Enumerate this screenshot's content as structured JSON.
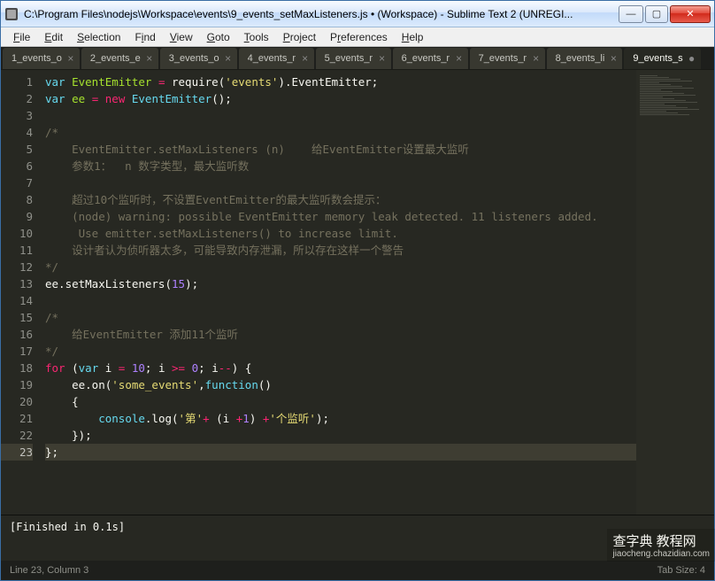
{
  "window": {
    "title": "C:\\Program Files\\nodejs\\Workspace\\events\\9_events_setMaxListeners.js • (Workspace) - Sublime Text 2 (UNREGI..."
  },
  "win_buttons": {
    "min": "—",
    "max": "▢",
    "close": "✕"
  },
  "menu": {
    "file": "File",
    "edit": "Edit",
    "selection": "Selection",
    "find": "Find",
    "view": "View",
    "goto": "Goto",
    "tools": "Tools",
    "project": "Project",
    "preferences": "Preferences",
    "help": "Help"
  },
  "tabs": [
    {
      "label": "1_events_o",
      "close": "×",
      "active": false
    },
    {
      "label": "2_events_e",
      "close": "×",
      "active": false
    },
    {
      "label": "3_events_o",
      "close": "×",
      "active": false
    },
    {
      "label": "4_events_r",
      "close": "×",
      "active": false
    },
    {
      "label": "5_events_r",
      "close": "×",
      "active": false
    },
    {
      "label": "6_events_r",
      "close": "×",
      "active": false
    },
    {
      "label": "7_events_r",
      "close": "×",
      "active": false
    },
    {
      "label": "8_events_li",
      "close": "×",
      "active": false
    },
    {
      "label": "9_events_s",
      "close": "●",
      "active": true
    }
  ],
  "code": {
    "highlight_line": 23,
    "lines": [
      {
        "n": 1,
        "tokens": [
          [
            "k-blue",
            "var"
          ],
          [
            "k-white",
            " "
          ],
          [
            "k-green",
            "EventEmitter"
          ],
          [
            "k-white",
            " "
          ],
          [
            "k-red",
            "="
          ],
          [
            "k-white",
            " require("
          ],
          [
            "k-yellow",
            "'events'"
          ],
          [
            "k-white",
            ")."
          ],
          [
            "k-white",
            "EventEmitter;"
          ]
        ]
      },
      {
        "n": 2,
        "tokens": [
          [
            "k-blue",
            "var"
          ],
          [
            "k-white",
            " "
          ],
          [
            "k-green",
            "ee"
          ],
          [
            "k-white",
            " "
          ],
          [
            "k-red",
            "="
          ],
          [
            "k-white",
            " "
          ],
          [
            "k-red",
            "new"
          ],
          [
            "k-white",
            " "
          ],
          [
            "k-blue",
            "EventEmitter"
          ],
          [
            "k-white",
            "();"
          ]
        ]
      },
      {
        "n": 3,
        "tokens": []
      },
      {
        "n": 4,
        "tokens": [
          [
            "k-gray",
            "/*"
          ]
        ]
      },
      {
        "n": 5,
        "tokens": [
          [
            "k-gray",
            "    EventEmitter.setMaxListeners (n)    给EventEmitter设置最大监听"
          ]
        ]
      },
      {
        "n": 6,
        "tokens": [
          [
            "k-gray",
            "    参数1：  n 数字类型，最大监听数"
          ]
        ]
      },
      {
        "n": 7,
        "tokens": []
      },
      {
        "n": 8,
        "tokens": [
          [
            "k-gray",
            "    超过10个监听时，不设置EventEmitter的最大监听数会提示："
          ]
        ]
      },
      {
        "n": 9,
        "tokens": [
          [
            "k-gray",
            "    (node) warning: possible EventEmitter memory leak detected. 11 listeners added."
          ]
        ]
      },
      {
        "n": 10,
        "tokens": [
          [
            "k-gray",
            "     Use emitter.setMaxListeners() to increase limit."
          ]
        ]
      },
      {
        "n": 11,
        "tokens": [
          [
            "k-gray",
            "    设计者认为侦听器太多，可能导致内存泄漏，所以存在这样一个警告"
          ]
        ]
      },
      {
        "n": 12,
        "tokens": [
          [
            "k-gray",
            "*/"
          ]
        ]
      },
      {
        "n": 13,
        "tokens": [
          [
            "k-white",
            "ee.setMaxListeners("
          ],
          [
            "k-purple",
            "15"
          ],
          [
            "k-white",
            ");"
          ]
        ]
      },
      {
        "n": 14,
        "tokens": []
      },
      {
        "n": 15,
        "tokens": [
          [
            "k-gray",
            "/*"
          ]
        ]
      },
      {
        "n": 16,
        "tokens": [
          [
            "k-gray",
            "    给EventEmitter 添加11个监听"
          ]
        ]
      },
      {
        "n": 17,
        "tokens": [
          [
            "k-gray",
            "*/"
          ]
        ]
      },
      {
        "n": 18,
        "tokens": [
          [
            "k-red",
            "for"
          ],
          [
            "k-white",
            " ("
          ],
          [
            "k-blue",
            "var"
          ],
          [
            "k-white",
            " i "
          ],
          [
            "k-red",
            "="
          ],
          [
            "k-white",
            " "
          ],
          [
            "k-purple",
            "10"
          ],
          [
            "k-white",
            "; i "
          ],
          [
            "k-red",
            ">="
          ],
          [
            "k-white",
            " "
          ],
          [
            "k-purple",
            "0"
          ],
          [
            "k-white",
            "; i"
          ],
          [
            "k-red",
            "--"
          ],
          [
            "k-white",
            ") {"
          ]
        ]
      },
      {
        "n": 19,
        "tokens": [
          [
            "k-white",
            "    ee.on("
          ],
          [
            "k-yellow",
            "'some_events'"
          ],
          [
            "k-white",
            ","
          ],
          [
            "k-blue",
            "function"
          ],
          [
            "k-white",
            "()"
          ]
        ]
      },
      {
        "n": 20,
        "tokens": [
          [
            "k-white",
            "    {"
          ]
        ]
      },
      {
        "n": 21,
        "tokens": [
          [
            "k-white",
            "        "
          ],
          [
            "k-blue",
            "console"
          ],
          [
            "k-white",
            ".log("
          ],
          [
            "k-yellow",
            "'第'"
          ],
          [
            "k-red",
            "+"
          ],
          [
            "k-white",
            " (i "
          ],
          [
            "k-red",
            "+"
          ],
          [
            "k-purple",
            "1"
          ],
          [
            "k-white",
            ") "
          ],
          [
            "k-red",
            "+"
          ],
          [
            "k-yellow",
            "'个监听'"
          ],
          [
            "k-white",
            ");"
          ]
        ]
      },
      {
        "n": 22,
        "tokens": [
          [
            "k-white",
            "    });"
          ]
        ]
      },
      {
        "n": 23,
        "tokens": [
          [
            "k-white",
            "};"
          ]
        ]
      }
    ]
  },
  "console": {
    "output": "[Finished in 0.1s]"
  },
  "statusbar": {
    "position": "Line 23, Column 3",
    "tab_size": "Tab Size: 4"
  },
  "watermark": {
    "main": "查字典 教程网",
    "sub": "jiaocheng.chazidian.com"
  }
}
